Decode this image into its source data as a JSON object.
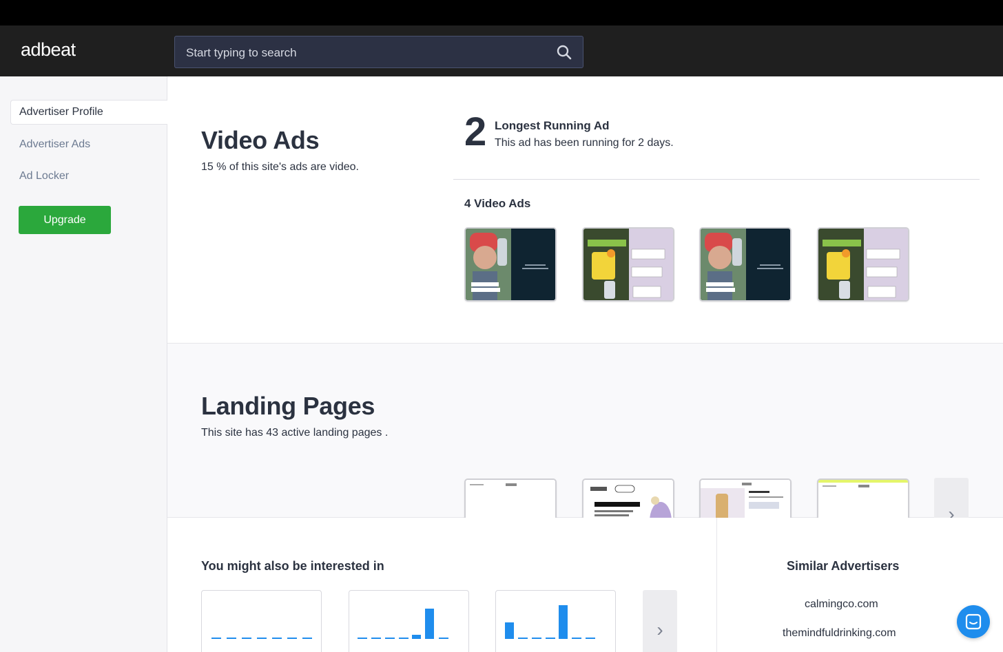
{
  "app": {
    "logo": "adbeat"
  },
  "search": {
    "placeholder": "Start typing to search"
  },
  "sidebar": {
    "items": [
      {
        "label": "Advertiser Profile"
      },
      {
        "label": "Advertiser Ads"
      },
      {
        "label": "Ad Locker"
      }
    ],
    "upgrade_label": "Upgrade"
  },
  "video": {
    "title": "Video Ads",
    "subtitle": "15 % of this site's ads are video.",
    "longest_days": "2",
    "longest_title": "Longest Running Ad",
    "longest_text": "This ad has been running for 2 days.",
    "count_title": "4 Video Ads"
  },
  "landing": {
    "title": "Landing Pages",
    "subtitle": "This site has 43 active landing pages ."
  },
  "bottom": {
    "interest_title": "You might also be interested in",
    "similar_title": "Similar Advertisers",
    "similar": [
      "calmingco.com",
      "themindfuldrinking.com"
    ]
  },
  "colors": {
    "accent": "#2ba83c",
    "chart": "#1f8ded",
    "header": "#1f1f1f"
  }
}
